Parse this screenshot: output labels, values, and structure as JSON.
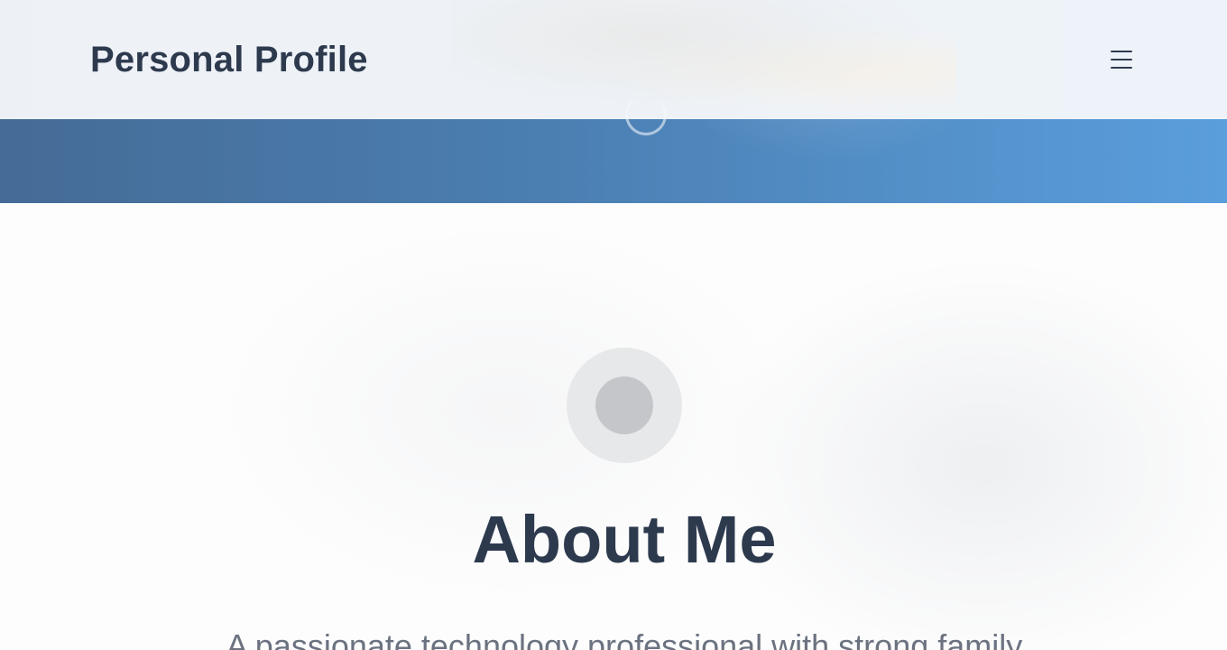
{
  "header": {
    "brand": "Personal Profile",
    "menu_icon": "hamburger-menu-icon"
  },
  "hero": {
    "loading_icon": "spinner-icon"
  },
  "about": {
    "avatar_icon": "avatar-placeholder-icon",
    "title": "About Me",
    "text": "A passionate technology professional with strong family"
  },
  "colors": {
    "text_dark": "#2d3a4e",
    "text_muted": "#6b7280",
    "hero_start": "#456b96",
    "hero_end": "#5a9edc",
    "avatar_bg": "#e7e8ea",
    "avatar_fg": "#c4c6ca"
  }
}
